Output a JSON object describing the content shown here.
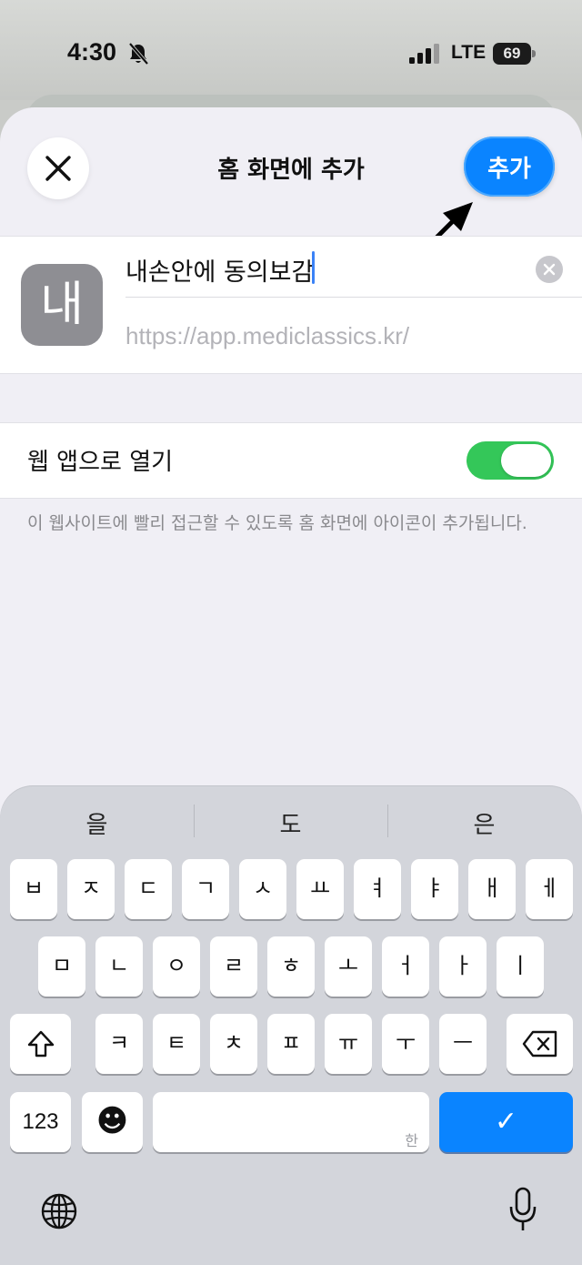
{
  "status_bar": {
    "time": "4:30",
    "network": "LTE",
    "battery": "69"
  },
  "sheet": {
    "title": "홈 화면에 추가",
    "add_label": "추가",
    "close_icon": "close-icon"
  },
  "bookmark": {
    "icon_letter": "내",
    "name_value": "내손안에 동의보감",
    "url": "https://app.mediclassics.kr/"
  },
  "web_app_toggle": {
    "label": "웹 앱으로 열기",
    "enabled": true
  },
  "footnote": "이 웹사이트에 빨리 접근할 수 있도록 홈 화면에 아이콘이 추가됩니다.",
  "keyboard": {
    "suggestions": [
      "을",
      "도",
      "은"
    ],
    "row1": [
      "ㅂ",
      "ㅈ",
      "ㄷ",
      "ㄱ",
      "ㅅ",
      "ㅛ",
      "ㅕ",
      "ㅑ",
      "ㅐ",
      "ㅔ"
    ],
    "row2": [
      "ㅁ",
      "ㄴ",
      "ㅇ",
      "ㄹ",
      "ㅎ",
      "ㅗ",
      "ㅓ",
      "ㅏ",
      "ㅣ"
    ],
    "row3": [
      "ㅋ",
      "ㅌ",
      "ㅊ",
      "ㅍ",
      "ㅠ",
      "ㅜ",
      "ㅡ"
    ],
    "numbers_label": "123",
    "space_hint": "한",
    "done_symbol": "✓",
    "emoji_symbol": "☻"
  },
  "colors": {
    "accent": "#0a84ff",
    "toggle_on": "#34c759",
    "icon_gray": "#8e8e93"
  }
}
